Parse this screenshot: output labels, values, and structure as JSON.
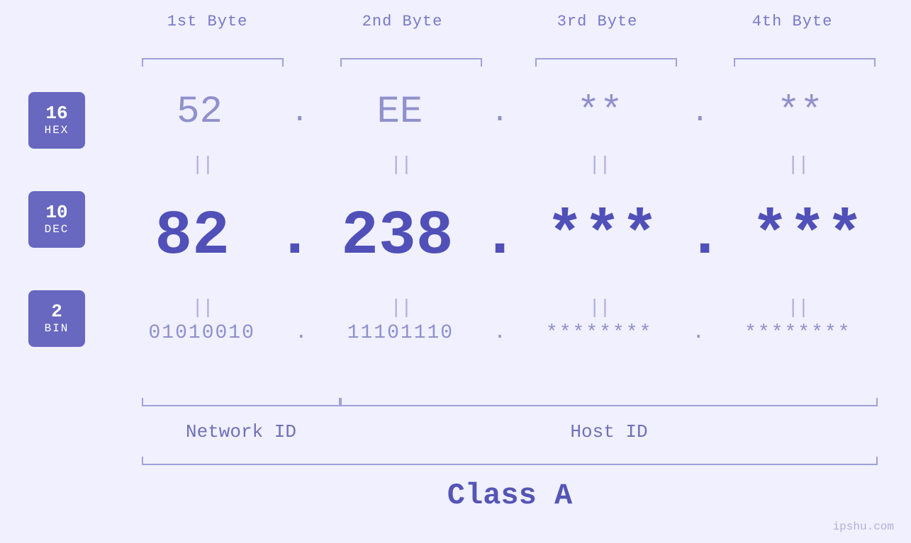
{
  "header": {
    "bytes": [
      "1st Byte",
      "2nd Byte",
      "3rd Byte",
      "4th Byte"
    ]
  },
  "badges": [
    {
      "num": "16",
      "label": "HEX"
    },
    {
      "num": "10",
      "label": "DEC"
    },
    {
      "num": "2",
      "label": "BIN"
    }
  ],
  "hex": {
    "b1": "52",
    "b2": "EE",
    "b3": "**",
    "b4": "**",
    "dot": "."
  },
  "dec": {
    "b1": "82",
    "b2": "238",
    "b3": "***",
    "b4": "***",
    "dot": "."
  },
  "bin": {
    "b1": "01010010",
    "b2": "11101110",
    "b3": "********",
    "b4": "********",
    "dot": "."
  },
  "labels": {
    "network_id": "Network ID",
    "host_id": "Host ID",
    "class": "Class A",
    "watermark": "ipshu.com"
  }
}
